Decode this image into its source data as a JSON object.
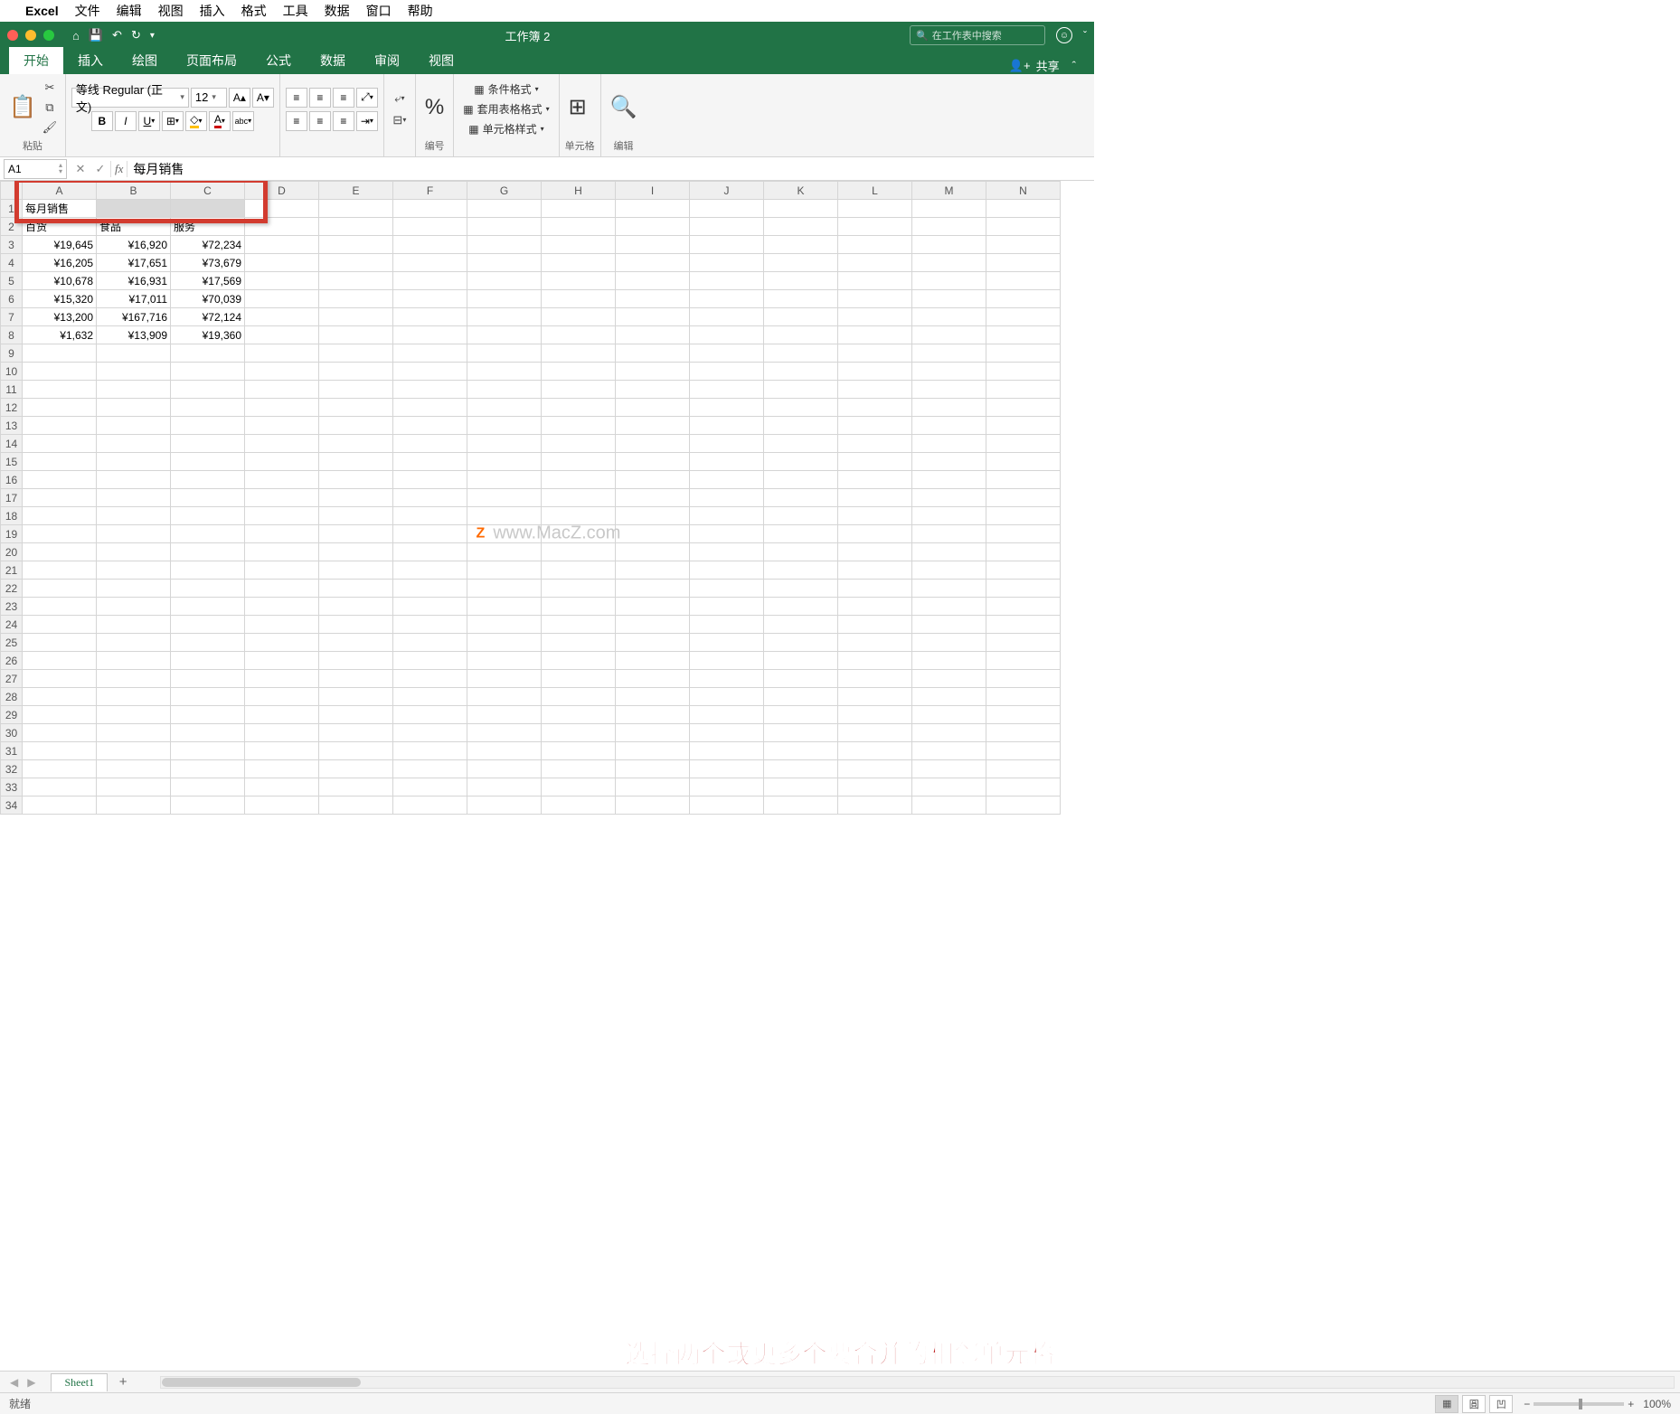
{
  "mac_menu": {
    "app": "Excel",
    "items": [
      "文件",
      "编辑",
      "视图",
      "插入",
      "格式",
      "工具",
      "数据",
      "窗口",
      "帮助"
    ]
  },
  "titlebar": {
    "doc_title": "工作簿 2",
    "search_placeholder": "在工作表中搜索"
  },
  "ribbon_tabs": [
    "开始",
    "插入",
    "绘图",
    "页面布局",
    "公式",
    "数据",
    "审阅",
    "视图"
  ],
  "ribbon_active_tab": "开始",
  "share_label": "共享",
  "ribbon": {
    "paste_label": "粘贴",
    "font_name": "等线 Regular (正文)",
    "font_size": "12",
    "number_label": "编号",
    "cond_fmt": "条件格式",
    "table_fmt": "套用表格格式",
    "cell_style": "单元格样式",
    "cells_label": "单元格",
    "edit_label": "编辑"
  },
  "formula": {
    "name_box": "A1",
    "content": "每月销售"
  },
  "columns": [
    "A",
    "B",
    "C",
    "D",
    "E",
    "F",
    "G",
    "H",
    "I",
    "J",
    "K",
    "L",
    "M",
    "N"
  ],
  "rows_visible": 34,
  "data": {
    "a1": "每月销售",
    "a2": "百货",
    "b2": "食品",
    "c2": "服务",
    "table": [
      [
        "¥19,645",
        "¥16,920",
        "¥72,234"
      ],
      [
        "¥16,205",
        "¥17,651",
        "¥73,679"
      ],
      [
        "¥10,678",
        "¥16,931",
        "¥17,569"
      ],
      [
        "¥15,320",
        "¥17,011",
        "¥70,039"
      ],
      [
        "¥13,200",
        "¥167,716",
        "¥72,124"
      ],
      [
        "¥1,632",
        "¥13,909",
        "¥19,360"
      ]
    ]
  },
  "watermark": "www.MacZ.com",
  "annotation": "选择两个或更多个要合并的相邻单元格",
  "sheet_tab": "Sheet1",
  "status_ready": "就绪",
  "zoom_label": "100%"
}
